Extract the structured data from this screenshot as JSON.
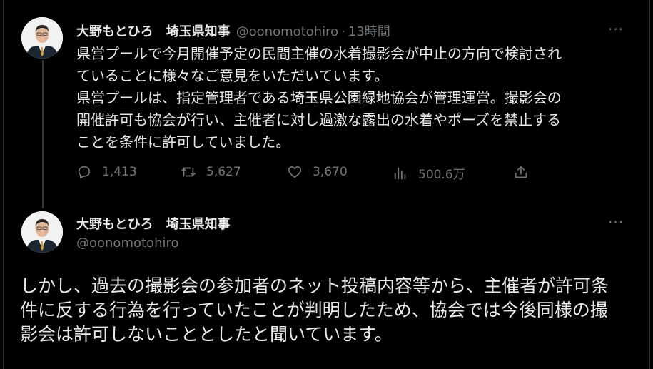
{
  "tweet1": {
    "display_name": "大野もとひろ　埼玉県知事",
    "handle": "@oonomotohiro",
    "separator": "·",
    "time": "13時間",
    "more": "···",
    "text": "県営プールで今月開催予定の民間主催の水着撮影会が中止の方向で検討され\nていることに様々なご意見をいただいています。\n県営プールは、指定管理者である埼玉県公園緑地協会が管理運営。撮影会の\n開催許可も協会が行い、主催者に対し過激な露出の水着やポーズを禁止する\nことを条件に許可していました。",
    "actions": {
      "reply": {
        "icon": "reply-icon",
        "count": "1,413"
      },
      "retweet": {
        "icon": "retweet-icon",
        "count": "5,627"
      },
      "like": {
        "icon": "like-icon",
        "count": "3,670"
      },
      "views": {
        "icon": "views-icon",
        "count": "500.6万"
      },
      "share": {
        "icon": "share-icon"
      }
    }
  },
  "tweet2": {
    "display_name": "大野もとひろ　埼玉県知事",
    "handle": "@oonomotohiro",
    "more": "···",
    "text": "しかし、過去の撮影会の参加者のネット投稿内容等から、主催者が許可条\n件に反する行為を行っていたことが判明したため、協会では今後同様の撮\n影会は許可しないこととしたと聞いています。"
  },
  "colors": {
    "background": "#000000",
    "text": "#e7e9ea",
    "secondary": "#71767b",
    "thread_line": "#333639"
  }
}
